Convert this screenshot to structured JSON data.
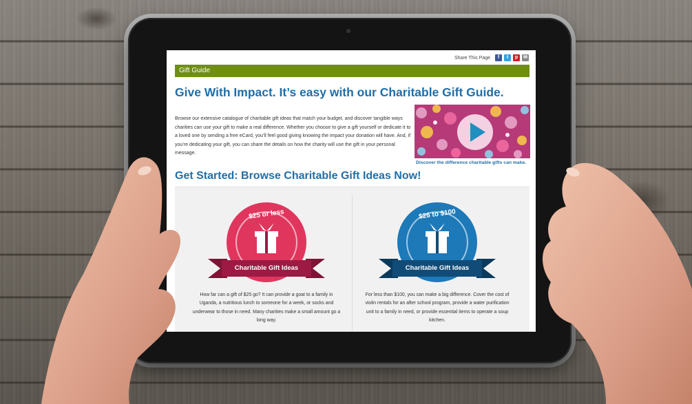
{
  "page": {
    "share_label": "Share This Page",
    "social_icons": [
      "facebook-icon",
      "twitter-icon",
      "pinterest-icon",
      "email-icon"
    ],
    "breadcrumb": "Gift Guide",
    "headline": "Give With Impact. It’s easy with our Charitable Gift Guide.",
    "intro": "Browse our extensive catalogue of charitable gift ideas that match your budget, and discover tangible ways charities can use your gift to make a real difference.  Whether you choose to give a gift yourself or dedicate it to a loved one by sending a free eCard, you’ll feel good giving knowing the impact your donation will have. And, if you’re dedicating your gift, you can share the details on how the charity will use the gift in your personal message.",
    "video_caption": "Discover the difference charitable gifts can make.",
    "section_title": "Get Started: Browse Charitable Gift Ideas Now!",
    "cards": [
      {
        "badge_price": "$25 or less",
        "badge_ribbon": "Charitable Gift Ideas",
        "badge_color": "#e0365e",
        "ribbon_color": "#9c1a44",
        "text": "How far can a gift of $25 go? It can provide a goat to a family in Uganda, a nutritious lunch to someone for a week, or socks and underwear to those in need. Many charities make a small amount go a long way."
      },
      {
        "badge_price": "$26 to $100",
        "badge_ribbon": "Charitable Gift Ideas",
        "badge_color": "#1d79b8",
        "ribbon_color": "#114c78",
        "text": "For less than $100, you can make a big difference. Cover the cost of violin rentals for an after school program, provide a water purification unit to a family in need, or provide essential items to operate a soup kitchen."
      }
    ]
  },
  "colors": {
    "header_green": "#6f8e14",
    "title_blue": "#1f6ea8",
    "video_bg": "#b63a78",
    "play_button": "#1f8fbf"
  }
}
